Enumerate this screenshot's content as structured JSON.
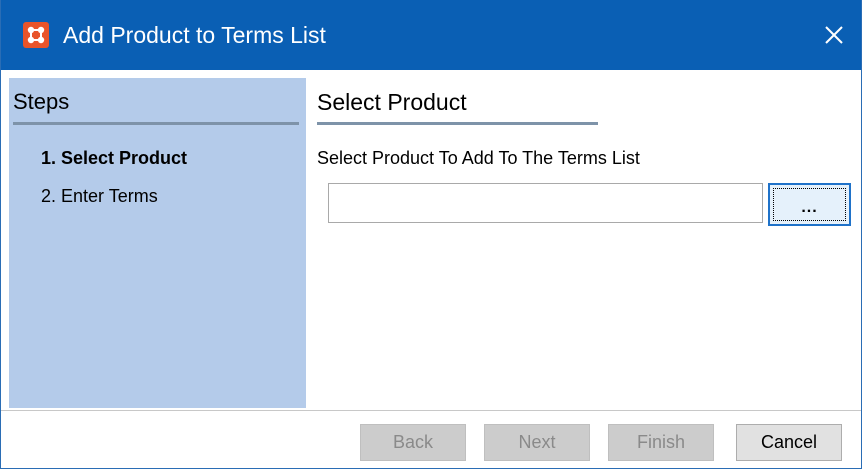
{
  "window": {
    "title": "Add Product to Terms List",
    "close_glyph": "✕",
    "app_icon": "wizard-app-icon"
  },
  "colors": {
    "titlebar": "#0a5fb4",
    "steps_panel": "#b4cbea",
    "app_icon": "#e8542a",
    "focus_border": "#1f72c9"
  },
  "steps_panel": {
    "header": "Steps",
    "items": [
      {
        "label": "1. Select Product",
        "active": true
      },
      {
        "label": "2. Enter Terms",
        "active": false
      }
    ]
  },
  "content": {
    "title": "Select Product",
    "field_label": "Select Product To Add To The Terms List",
    "product_input": {
      "value": "",
      "placeholder": ""
    },
    "browse_label": "..."
  },
  "footer": {
    "back_label": "Back",
    "next_label": "Next",
    "finish_label": "Finish",
    "cancel_label": "Cancel"
  }
}
